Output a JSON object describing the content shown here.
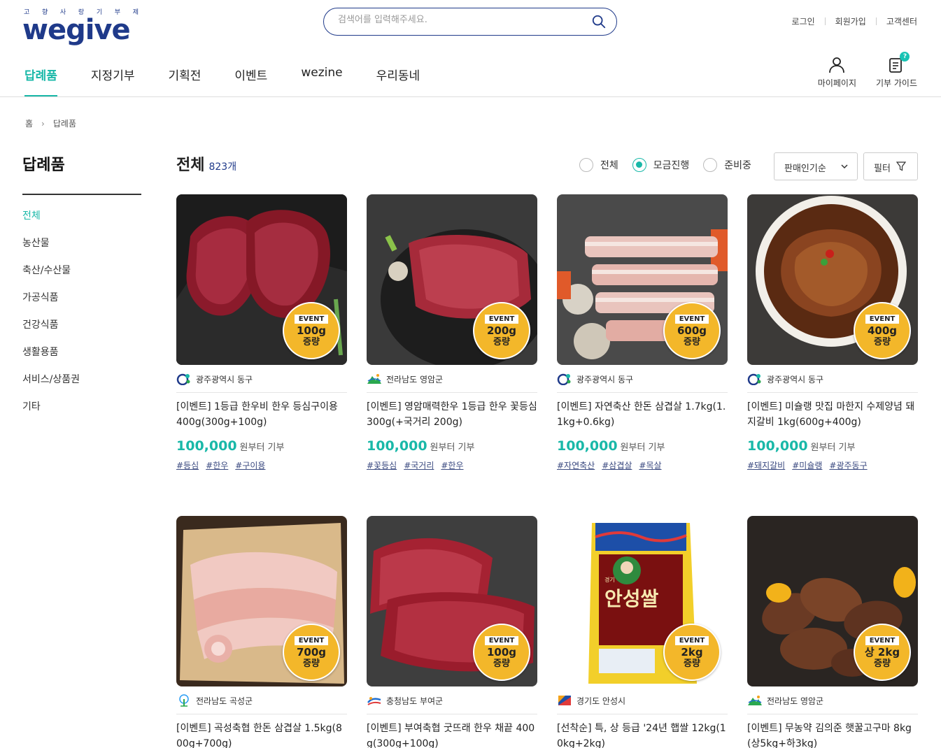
{
  "brand": {
    "tagline": [
      "고",
      "향",
      "사",
      "랑",
      "기",
      "부",
      "제"
    ],
    "logo_text": "wegive"
  },
  "search": {
    "placeholder": "검색어를 입력해주세요."
  },
  "util_links": [
    "로그인",
    "회원가입",
    "고객센터"
  ],
  "gnb": [
    "답례품",
    "지정기부",
    "기획전",
    "이벤트",
    "wezine",
    "우리동네"
  ],
  "header_icons": {
    "mypage": "마이페이지",
    "guide": "기부 가이드",
    "guide_badge": "?"
  },
  "breadcrumb": {
    "home": "홈",
    "current": "답례품"
  },
  "sidebar": {
    "title": "답례품",
    "items": [
      "전체",
      "농산물",
      "축산/수산물",
      "가공식품",
      "건강식품",
      "생활용품",
      "서비스/상품권",
      "기타"
    ]
  },
  "content": {
    "title": "전체",
    "count": "823개",
    "status_options": [
      "전체",
      "모금진행",
      "준비중"
    ],
    "status_selected": "모금진행",
    "sort_value": "판매인기순",
    "filter_label": "필터"
  },
  "products": [
    {
      "region": "광주광역시 동구",
      "title": "[이벤트] 1등급 한우비 한우 등심구이용 400g(300g+100g)",
      "price": "100,000",
      "price_unit": "원부터 기부",
      "tags": [
        "#등심",
        "#한우",
        "#구이용"
      ],
      "badge": {
        "event": "EVENT",
        "amount": "100g",
        "inc": "증량"
      }
    },
    {
      "region": "전라남도 영암군",
      "title": "[이벤트] 영암매력한우 1등급 한우 꽃등심 300g(+국거리 200g)",
      "price": "100,000",
      "price_unit": "원부터 기부",
      "tags": [
        "#꽃등심",
        "#국거리",
        "#한우"
      ],
      "badge": {
        "event": "EVENT",
        "amount": "200g",
        "inc": "증량"
      }
    },
    {
      "region": "광주광역시 동구",
      "title": "[이벤트] 자연축산 한돈 삼겹살 1.7kg(1.1kg+0.6kg)",
      "price": "100,000",
      "price_unit": "원부터 기부",
      "tags": [
        "#자연축산",
        "#삼겹살",
        "#목살"
      ],
      "badge": {
        "event": "EVENT",
        "amount": "600g",
        "inc": "증량"
      }
    },
    {
      "region": "광주광역시 동구",
      "title": "[이벤트] 미슐랭 맛집 마한지 수제양념 돼지갈비 1kg(600g+400g)",
      "price": "100,000",
      "price_unit": "원부터 기부",
      "tags": [
        "#돼지갈비",
        "#미슐랭",
        "#광주동구"
      ],
      "badge": {
        "event": "EVENT",
        "amount": "400g",
        "inc": "증량"
      }
    },
    {
      "region": "전라남도 곡성군",
      "title": "[이벤트] 곡성축협 한돈 삼겹살 1.5kg(800g+700g)",
      "price": "",
      "price_unit": "",
      "tags": [],
      "badge": {
        "event": "EVENT",
        "amount": "700g",
        "inc": "증량"
      }
    },
    {
      "region": "충청남도 부여군",
      "title": "[이벤트] 부여축협 굿뜨래 한우 채끝 400g(300g+100g)",
      "price": "",
      "price_unit": "",
      "tags": [],
      "badge": {
        "event": "EVENT",
        "amount": "100g",
        "inc": "증량"
      }
    },
    {
      "region": "경기도 안성시",
      "title": "[선착순] 특, 상 등급 '24년 햅쌀 12kg(10kg+2kg)",
      "price": "",
      "price_unit": "",
      "tags": [],
      "badge": {
        "event": "EVENT",
        "amount": "2kg",
        "inc": "증량"
      }
    },
    {
      "region": "전라남도 영암군",
      "title": "[이벤트] 무농약 김의준 햇꿀고구마 8kg(상5kg+하3kg)",
      "price": "",
      "price_unit": "",
      "tags": [],
      "badge": {
        "event": "EVENT",
        "amount": "상 2kg",
        "inc": "증량"
      }
    }
  ],
  "rice_bag": {
    "brand": "안성쌀",
    "region_word": "경기"
  },
  "colors": {
    "brand_navy": "#1f3a8a",
    "accent_teal": "#19b8a8",
    "event_yellow": "#f3b72a"
  }
}
